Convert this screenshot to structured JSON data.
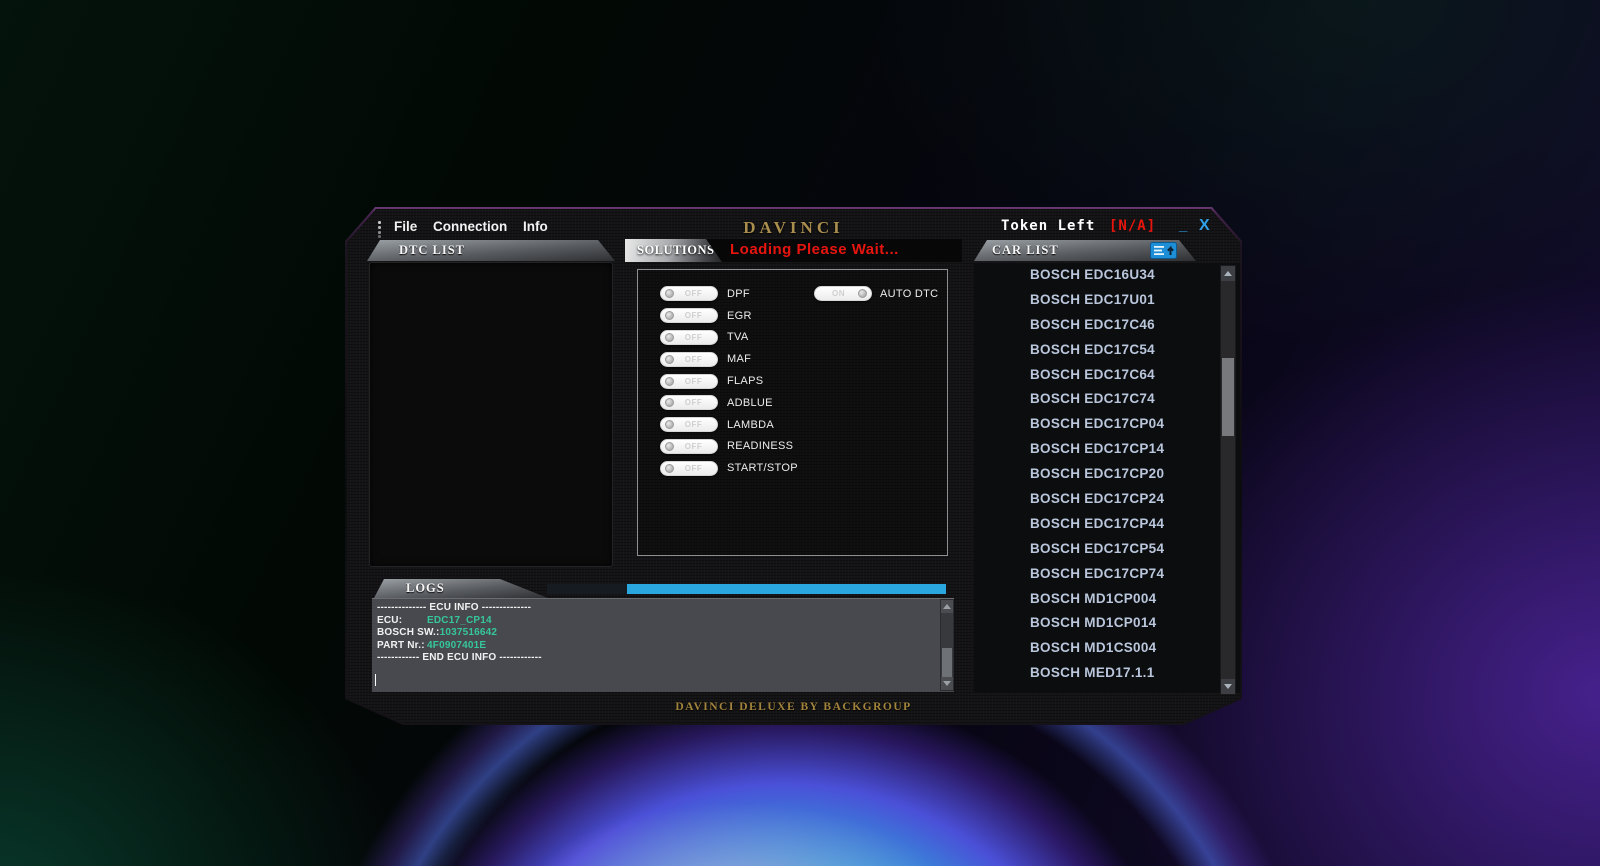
{
  "window": {
    "menu": {
      "items": [
        {
          "label": "File"
        },
        {
          "label": "Connection"
        },
        {
          "label": "Info"
        }
      ]
    },
    "title": "DAVINCI",
    "token": {
      "label": "Token Left",
      "value": "[N/A]"
    },
    "minimize_label": "_",
    "close_label": "X",
    "footer": "DAVINCI DELUXE BY BACKGROUP"
  },
  "dtc_panel": {
    "header": "DTC LIST"
  },
  "solutions": {
    "tab": "SOLUTIONS",
    "status": "Loading Please Wait...",
    "toggles": [
      {
        "label": "DPF",
        "state": "OFF"
      },
      {
        "label": "EGR",
        "state": "OFF"
      },
      {
        "label": "TVA",
        "state": "OFF"
      },
      {
        "label": "MAF",
        "state": "OFF"
      },
      {
        "label": "FLAPS",
        "state": "OFF"
      },
      {
        "label": "ADBLUE",
        "state": "OFF"
      },
      {
        "label": "LAMBDA",
        "state": "OFF"
      },
      {
        "label": "READINESS",
        "state": "OFF"
      },
      {
        "label": "START/STOP",
        "state": "OFF"
      }
    ],
    "auto_dtc": {
      "label": "AUTO DTC",
      "state": "ON"
    }
  },
  "car_list": {
    "header": "CAR LIST",
    "items": [
      "BOSCH EDC16U34",
      "BOSCH EDC17U01",
      "BOSCH EDC17C46",
      "BOSCH EDC17C54",
      "BOSCH EDC17C64",
      "BOSCH EDC17C74",
      "BOSCH EDC17CP04",
      "BOSCH EDC17CP14",
      "BOSCH EDC17CP20",
      "BOSCH EDC17CP24",
      "BOSCH EDC17CP44",
      "BOSCH EDC17CP54",
      "BOSCH EDC17CP74",
      "BOSCH MD1CP004",
      "BOSCH MD1CP014",
      "BOSCH MD1CS004",
      "BOSCH MED17.1.1"
    ]
  },
  "logs": {
    "header": "LOGS",
    "progress_percent": 80,
    "lines": [
      {
        "label": "-------------- ECU INFO --------------",
        "value": ""
      },
      {
        "label": "ECU:",
        "value": "EDC17_CP14"
      },
      {
        "label": "BOSCH SW.:",
        "value": "1037516642"
      },
      {
        "label": "PART Nr.:",
        "value": "4F0907401E"
      },
      {
        "label": "------------ END ECU INFO ------------",
        "value": ""
      }
    ]
  },
  "colors": {
    "accent_blue": "#2ba7e0",
    "alert_red": "#e8150f",
    "brand_gold": "#a98e4e",
    "value_teal": "#35c79a",
    "car_item_text": "#b9c6dc"
  }
}
